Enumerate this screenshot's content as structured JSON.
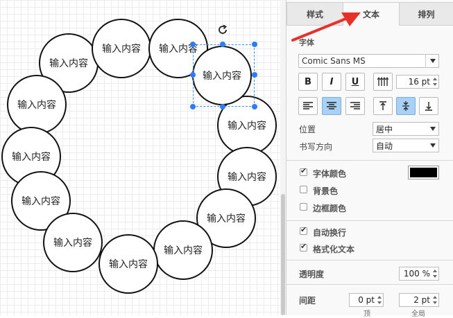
{
  "canvas": {
    "circle_label": "输入内容",
    "circles": [
      {
        "label": "输入内容"
      },
      {
        "label": "输入内容"
      },
      {
        "label": "输入内容"
      },
      {
        "label": "输入内容"
      },
      {
        "label": "输入内容"
      },
      {
        "label": "输入内容"
      },
      {
        "label": "输入内容"
      },
      {
        "label": "输入内容"
      },
      {
        "label": "输入内容"
      },
      {
        "label": "输入内容"
      },
      {
        "label": "输入内容"
      },
      {
        "label": "输入内容"
      },
      {
        "label": "输入内容"
      },
      {
        "label": "输入内容"
      }
    ]
  },
  "panel": {
    "tabs": [
      {
        "label": "样式"
      },
      {
        "label": "文本"
      },
      {
        "label": "排列"
      }
    ],
    "active_tab": "文本",
    "font_section": "字体",
    "font_family": "Comic Sans MS",
    "bold": "B",
    "italic": "I",
    "underline": "U",
    "font_size": "16 pt",
    "position_label": "位置",
    "position_value": "居中",
    "direction_label": "书写方向",
    "direction_value": "自动",
    "font_color_label": "字体颜色",
    "font_color_checked": true,
    "font_color_value": "#000000",
    "background_label": "背景色",
    "background_checked": false,
    "border_label": "边框颜色",
    "border_checked": false,
    "wrap_label": "自动换行",
    "wrap_checked": true,
    "format_label": "格式化文本",
    "format_checked": true,
    "opacity_label": "透明度",
    "opacity_value": "100 %",
    "spacing_label": "间距",
    "spacing_top": "0 pt",
    "spacing_global": "2 pt",
    "spacing_top_label": "顶",
    "spacing_global_label": "全局"
  },
  "colors": {
    "accent": "#2f7cf6",
    "selected_button": "#a9d0f5",
    "arrow": "#e8312a"
  }
}
